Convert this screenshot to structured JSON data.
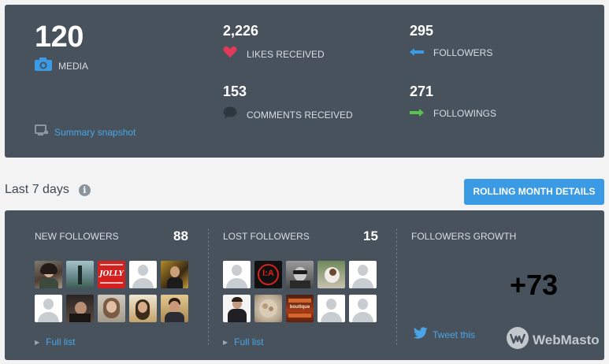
{
  "summary": {
    "media": {
      "count": "120",
      "label": "MEDIA",
      "icon": "camera-icon"
    },
    "likes": {
      "count": "2,226",
      "label": "LIKES RECEIVED",
      "icon": "heart-icon",
      "color": "#e03a5a"
    },
    "comments": {
      "count": "153",
      "label": "COMMENTS RECEIVED",
      "icon": "speech-bubble-icon"
    },
    "followers": {
      "count": "295",
      "label": "FOLLOWERS",
      "icon": "arrow-left-icon",
      "color": "#3a9ae3"
    },
    "followings": {
      "count": "271",
      "label": "FOLLOWINGS",
      "icon": "arrow-right-icon",
      "color": "#5bc14f"
    },
    "snapshot_link": "Summary snapshot"
  },
  "period": {
    "title": "Last 7 days",
    "info_icon": "i",
    "rolling_button": "ROLLING MONTH DETAILS"
  },
  "new_followers": {
    "title": "NEW FOLLOWERS",
    "count": "88",
    "full_list": "Full list"
  },
  "lost_followers": {
    "title": "LOST FOLLOWERS",
    "count": "15",
    "full_list": "Full list"
  },
  "growth": {
    "title": "FOLLOWERS GROWTH",
    "value": "+73",
    "tweet": "Tweet this"
  },
  "avatar_logo_text": {
    "jolly": "JOLLY",
    "la": "I:A",
    "boutique": "boutique"
  },
  "watermark": "WebMasto",
  "colors": {
    "panel": "#48525c",
    "accent": "#3a9ae3",
    "link": "#49a5e6"
  }
}
